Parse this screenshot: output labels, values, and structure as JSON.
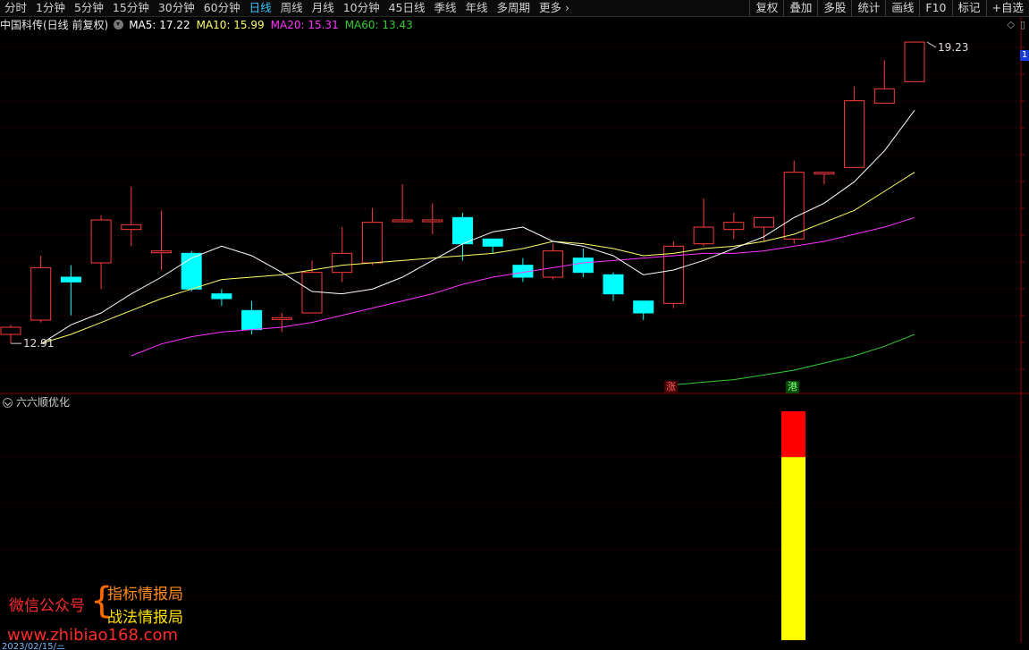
{
  "toolbar": {
    "periods": [
      "分时",
      "1分钟",
      "5分钟",
      "15分钟",
      "30分钟",
      "60分钟",
      "日线",
      "周线",
      "月线",
      "10分钟",
      "45日线",
      "季线",
      "年线",
      "多周期",
      "更多"
    ],
    "active_period": "日线",
    "right_buttons": [
      "复权",
      "叠加",
      "多股",
      "统计",
      "画线",
      "F10",
      "标记",
      "+自选"
    ]
  },
  "info": {
    "stock": "中国科传(日线 前复权)",
    "ma5": "MA5: 17.22",
    "ma10": "MA10: 15.99",
    "ma20": "MA20: 15.31",
    "ma60": "MA60: 13.43"
  },
  "colors": {
    "up": "#ff3b3b",
    "down": "#00ffff",
    "ma5": "#ffffff",
    "ma10": "#ffff66",
    "ma20": "#ff33ff",
    "ma60": "#33cc33"
  },
  "labels": {
    "high": "19.23",
    "low": "12.91",
    "edge": "1",
    "mark_zhang": "涨",
    "mark_gang": "港"
  },
  "indicator": {
    "title": "六六顺优化",
    "bar_red_fraction": 0.2,
    "bar_yellow_fraction": 0.8
  },
  "watermark": {
    "left": "微信公众号",
    "line1": "指标情报局",
    "line2": "战法情报局",
    "site": "www.zhibiao168.com"
  },
  "date_label": "2023/02/15/三",
  "chart_data": {
    "type": "candlestick",
    "high_label": 19.23,
    "low_label": 12.91,
    "candles": [
      {
        "o": 13.1,
        "c": 13.25,
        "h": 13.3,
        "l": 12.91
      },
      {
        "o": 13.4,
        "c": 14.5,
        "h": 14.75,
        "l": 13.35
      },
      {
        "o": 14.3,
        "c": 14.2,
        "h": 14.55,
        "l": 13.5
      },
      {
        "o": 14.6,
        "c": 15.5,
        "h": 15.6,
        "l": 14.05
      },
      {
        "o": 15.3,
        "c": 15.4,
        "h": 16.2,
        "l": 14.95
      },
      {
        "o": 14.85,
        "c": 14.85,
        "h": 15.7,
        "l": 14.45
      },
      {
        "o": 14.8,
        "c": 14.05,
        "h": 14.85,
        "l": 14.0
      },
      {
        "o": 13.95,
        "c": 13.85,
        "h": 14.05,
        "l": 13.7
      },
      {
        "o": 13.6,
        "c": 13.2,
        "h": 13.8,
        "l": 13.1
      },
      {
        "o": 13.45,
        "c": 13.45,
        "h": 13.55,
        "l": 13.15
      },
      {
        "o": 13.55,
        "c": 14.4,
        "h": 14.65,
        "l": 13.55
      },
      {
        "o": 14.4,
        "c": 14.8,
        "h": 15.35,
        "l": 14.2
      },
      {
        "o": 14.6,
        "c": 15.45,
        "h": 15.75,
        "l": 14.55
      },
      {
        "o": 15.5,
        "c": 15.5,
        "h": 16.25,
        "l": 15.45
      },
      {
        "o": 15.5,
        "c": 15.5,
        "h": 15.85,
        "l": 15.2
      },
      {
        "o": 15.55,
        "c": 15.0,
        "h": 15.65,
        "l": 14.65
      },
      {
        "o": 15.1,
        "c": 14.95,
        "h": 15.1,
        "l": 14.8
      },
      {
        "o": 14.55,
        "c": 14.3,
        "h": 14.7,
        "l": 14.2
      },
      {
        "o": 14.3,
        "c": 14.85,
        "h": 15.0,
        "l": 14.25
      },
      {
        "o": 14.7,
        "c": 14.4,
        "h": 14.9,
        "l": 14.3
      },
      {
        "o": 14.35,
        "c": 13.95,
        "h": 14.4,
        "l": 13.8
      },
      {
        "o": 13.8,
        "c": 13.55,
        "h": 13.8,
        "l": 13.4
      },
      {
        "o": 13.75,
        "c": 14.95,
        "h": 15.05,
        "l": 13.65
      },
      {
        "o": 15.0,
        "c": 15.35,
        "h": 15.95,
        "l": 14.95
      },
      {
        "o": 15.3,
        "c": 15.45,
        "h": 15.65,
        "l": 15.1
      },
      {
        "o": 15.35,
        "c": 15.55,
        "h": 15.55,
        "l": 15.05
      },
      {
        "o": 15.1,
        "c": 16.5,
        "h": 16.75,
        "l": 15.0
      },
      {
        "o": 16.5,
        "c": 16.5,
        "h": 16.5,
        "l": 16.25
      },
      {
        "o": 16.6,
        "c": 18.0,
        "h": 18.3,
        "l": 16.6
      },
      {
        "o": 17.95,
        "c": 18.25,
        "h": 18.85,
        "l": 17.95
      },
      {
        "o": 18.4,
        "c": 19.23,
        "h": 19.23,
        "l": 18.4
      }
    ],
    "ma5": [
      null,
      12.9,
      13.3,
      13.55,
      13.95,
      14.3,
      14.7,
      14.95,
      14.75,
      14.4,
      14.0,
      13.95,
      14.05,
      14.3,
      14.65,
      15.0,
      15.25,
      15.35,
      15.05,
      14.95,
      14.75,
      14.35,
      14.45,
      14.65,
      14.9,
      15.15,
      15.55,
      15.85,
      16.3,
      16.95,
      17.8
    ],
    "ma10": [
      null,
      12.91,
      13.1,
      13.35,
      13.6,
      13.85,
      14.05,
      14.25,
      14.3,
      14.35,
      14.45,
      14.55,
      14.6,
      14.65,
      14.7,
      14.75,
      14.8,
      14.9,
      15.05,
      15.0,
      14.9,
      14.75,
      14.8,
      14.9,
      14.95,
      15.05,
      15.2,
      15.45,
      15.7,
      16.1,
      16.5
    ],
    "ma20": [
      null,
      null,
      null,
      null,
      12.65,
      12.9,
      13.05,
      13.15,
      13.2,
      13.25,
      13.35,
      13.5,
      13.65,
      13.8,
      13.95,
      14.15,
      14.3,
      14.4,
      14.5,
      14.6,
      14.65,
      14.7,
      14.75,
      14.8,
      14.8,
      14.85,
      14.95,
      15.05,
      15.2,
      15.35,
      15.55
    ],
    "ma60": [
      null,
      null,
      null,
      null,
      null,
      null,
      null,
      null,
      null,
      null,
      null,
      null,
      null,
      null,
      null,
      null,
      null,
      null,
      null,
      null,
      null,
      null,
      12.04,
      12.1,
      12.15,
      12.25,
      12.35,
      12.5,
      12.65,
      12.85,
      13.1
    ],
    "indicator_bar": {
      "red": 0.2,
      "yellow": 0.8
    }
  }
}
